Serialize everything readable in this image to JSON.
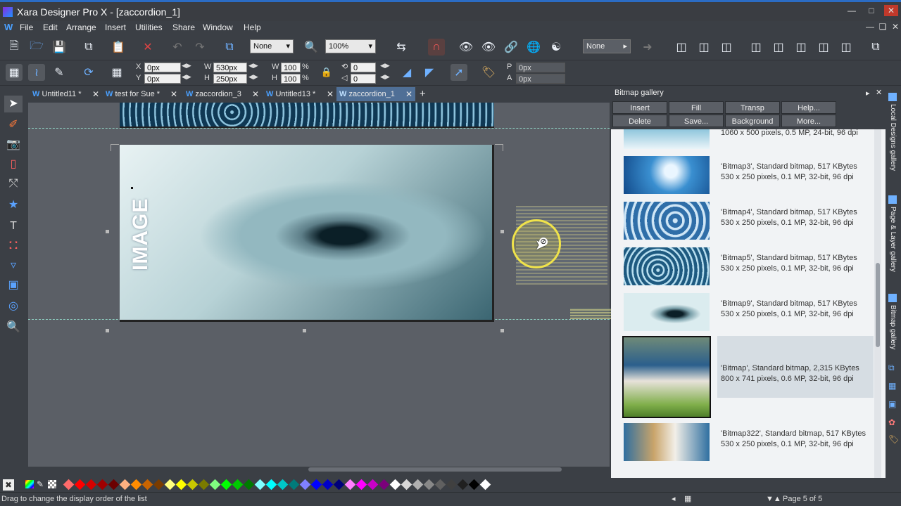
{
  "window": {
    "title": "Xara Designer Pro X - [zaccordion_1]"
  },
  "menu": [
    "File",
    "Edit",
    "Arrange",
    "Insert",
    "Utilities",
    "Share",
    "Window",
    "Help"
  ],
  "toolbar1": {
    "quality_select": "None",
    "zoom_select": "100%",
    "arrow_select": "None"
  },
  "toolbar2": {
    "x_label": "X",
    "x_value": "0px",
    "y_label": "Y",
    "y_value": "0px",
    "w_label": "W",
    "w_value": "530px",
    "h_label": "H",
    "h_value": "250px",
    "sw_label": "W",
    "sw_value": "100",
    "sh_label": "H",
    "sh_value": "100",
    "pct": "%",
    "rot_value": "0",
    "skew_value": "0",
    "p_label": "P",
    "p_value": "0px",
    "a_label": "A",
    "a_value": "0px"
  },
  "tabs": [
    {
      "label": "Untitled11 *"
    },
    {
      "label": "test for Sue *"
    },
    {
      "label": "zaccordion_3"
    },
    {
      "label": "Untitled13 *"
    },
    {
      "label": "zaccordion_1"
    }
  ],
  "canvas": {
    "image_text": "IMAGE"
  },
  "gallery": {
    "title": "Bitmap gallery",
    "buttons": [
      "Insert",
      "Fill",
      "Transp",
      "Help...",
      "Delete",
      "Save...",
      "Background",
      "More..."
    ],
    "items": [
      {
        "line1": "",
        "line2": "1060 x 500 pixels, 0.5 MP, 24-bit, 96 dpi"
      },
      {
        "line1": "'Bitmap3',  Standard bitmap,  517 KBytes",
        "line2": "530 x 250 pixels, 0.1 MP, 32-bit, 96 dpi"
      },
      {
        "line1": "'Bitmap4',  Standard bitmap,  517 KBytes",
        "line2": "530 x 250 pixels, 0.1 MP, 32-bit, 96 dpi"
      },
      {
        "line1": "'Bitmap5',  Standard bitmap,  517 KBytes",
        "line2": "530 x 250 pixels, 0.1 MP, 32-bit, 96 dpi"
      },
      {
        "line1": "'Bitmap9',  Standard bitmap,  517 KBytes",
        "line2": "530 x 250 pixels, 0.1 MP, 32-bit, 96 dpi"
      },
      {
        "line1": "'Bitmap',  Standard bitmap,  2,315 KBytes",
        "line2": "800 x 741 pixels, 0.6 MP, 32-bit, 96 dpi"
      },
      {
        "line1": "'Bitmap322',  Standard bitmap,  517 KBytes",
        "line2": "530 x 250 pixels, 0.1 MP, 32-bit, 96 dpi"
      }
    ]
  },
  "side_tabs": [
    "Local Designs gallery",
    "Page & Layer gallery",
    "Bitmap gallery"
  ],
  "status": {
    "message": "Drag to change the display order of the list",
    "page": "Page 5 of 5"
  }
}
